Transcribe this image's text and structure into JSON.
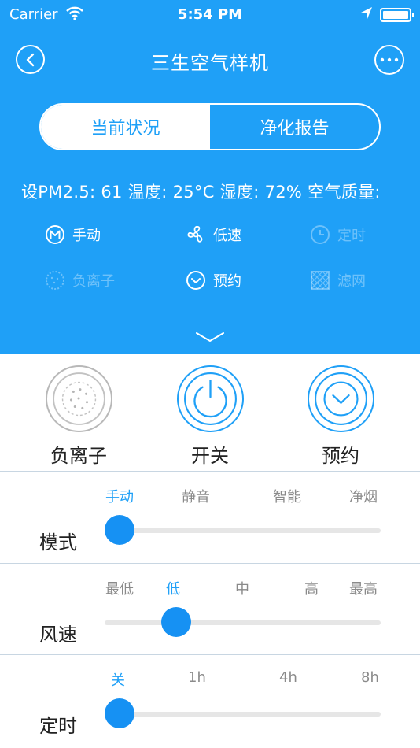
{
  "status_bar": {
    "carrier": "Carrier",
    "time": "5:54 PM"
  },
  "nav": {
    "title": "三生空气样机"
  },
  "segments": {
    "current": "当前状况",
    "report": "净化报告"
  },
  "readout": "设PM2.5: 61 温度: 25°C 湿度: 72% 空气质量:",
  "status_items": [
    {
      "icon": "mode-m-icon",
      "label": "手动",
      "enabled": true
    },
    {
      "icon": "fan-icon",
      "label": "低速",
      "enabled": true
    },
    {
      "icon": "clock-icon",
      "label": "定时",
      "enabled": false
    },
    {
      "icon": "anion-icon",
      "label": "负离子",
      "enabled": false
    },
    {
      "icon": "schedule-icon",
      "label": "预约",
      "enabled": true
    },
    {
      "icon": "filter-icon",
      "label": "滤网",
      "enabled": false
    }
  ],
  "controls": {
    "anion": "负离子",
    "power": "开关",
    "schedule": "预约"
  },
  "sliders": {
    "mode": {
      "name": "模式",
      "options": [
        "手动",
        "静音",
        "智能",
        "净烟"
      ],
      "selected_index": 0
    },
    "speed": {
      "name": "风速",
      "options": [
        "最低",
        "低",
        "中",
        "高",
        "最高"
      ],
      "selected_index": 1
    },
    "timer": {
      "name": "定时",
      "options": [
        "关",
        "1h",
        "4h",
        "8h"
      ],
      "selected_index": 0
    }
  },
  "colors": {
    "accent": "#1fa0f7",
    "thumb": "#1691f3",
    "inactive_text": "#8a8a8a"
  }
}
